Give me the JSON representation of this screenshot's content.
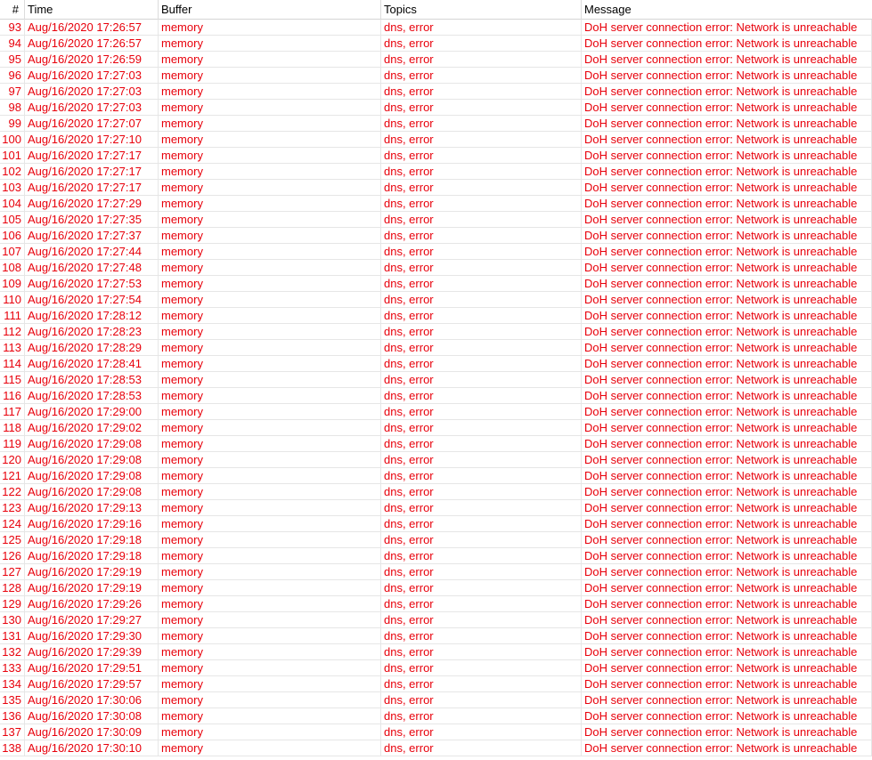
{
  "columns": {
    "num": "#",
    "time": "Time",
    "buffer": "Buffer",
    "topics": "Topics",
    "message": "Message"
  },
  "colors": {
    "error_text": "#e8000b",
    "header_text": "#000000",
    "grid_line": "#e6e6e6"
  },
  "rows": [
    {
      "num": "93",
      "time": "Aug/16/2020 17:26:57",
      "buffer": "memory",
      "topics": "dns, error",
      "message": "DoH server connection error: Network is unreachable"
    },
    {
      "num": "94",
      "time": "Aug/16/2020 17:26:57",
      "buffer": "memory",
      "topics": "dns, error",
      "message": "DoH server connection error: Network is unreachable"
    },
    {
      "num": "95",
      "time": "Aug/16/2020 17:26:59",
      "buffer": "memory",
      "topics": "dns, error",
      "message": "DoH server connection error: Network is unreachable"
    },
    {
      "num": "96",
      "time": "Aug/16/2020 17:27:03",
      "buffer": "memory",
      "topics": "dns, error",
      "message": "DoH server connection error: Network is unreachable"
    },
    {
      "num": "97",
      "time": "Aug/16/2020 17:27:03",
      "buffer": "memory",
      "topics": "dns, error",
      "message": "DoH server connection error: Network is unreachable"
    },
    {
      "num": "98",
      "time": "Aug/16/2020 17:27:03",
      "buffer": "memory",
      "topics": "dns, error",
      "message": "DoH server connection error: Network is unreachable"
    },
    {
      "num": "99",
      "time": "Aug/16/2020 17:27:07",
      "buffer": "memory",
      "topics": "dns, error",
      "message": "DoH server connection error: Network is unreachable"
    },
    {
      "num": "100",
      "time": "Aug/16/2020 17:27:10",
      "buffer": "memory",
      "topics": "dns, error",
      "message": "DoH server connection error: Network is unreachable"
    },
    {
      "num": "101",
      "time": "Aug/16/2020 17:27:17",
      "buffer": "memory",
      "topics": "dns, error",
      "message": "DoH server connection error: Network is unreachable"
    },
    {
      "num": "102",
      "time": "Aug/16/2020 17:27:17",
      "buffer": "memory",
      "topics": "dns, error",
      "message": "DoH server connection error: Network is unreachable"
    },
    {
      "num": "103",
      "time": "Aug/16/2020 17:27:17",
      "buffer": "memory",
      "topics": "dns, error",
      "message": "DoH server connection error: Network is unreachable"
    },
    {
      "num": "104",
      "time": "Aug/16/2020 17:27:29",
      "buffer": "memory",
      "topics": "dns, error",
      "message": "DoH server connection error: Network is unreachable"
    },
    {
      "num": "105",
      "time": "Aug/16/2020 17:27:35",
      "buffer": "memory",
      "topics": "dns, error",
      "message": "DoH server connection error: Network is unreachable"
    },
    {
      "num": "106",
      "time": "Aug/16/2020 17:27:37",
      "buffer": "memory",
      "topics": "dns, error",
      "message": "DoH server connection error: Network is unreachable"
    },
    {
      "num": "107",
      "time": "Aug/16/2020 17:27:44",
      "buffer": "memory",
      "topics": "dns, error",
      "message": "DoH server connection error: Network is unreachable"
    },
    {
      "num": "108",
      "time": "Aug/16/2020 17:27:48",
      "buffer": "memory",
      "topics": "dns, error",
      "message": "DoH server connection error: Network is unreachable"
    },
    {
      "num": "109",
      "time": "Aug/16/2020 17:27:53",
      "buffer": "memory",
      "topics": "dns, error",
      "message": "DoH server connection error: Network is unreachable"
    },
    {
      "num": "110",
      "time": "Aug/16/2020 17:27:54",
      "buffer": "memory",
      "topics": "dns, error",
      "message": "DoH server connection error: Network is unreachable"
    },
    {
      "num": "111",
      "time": "Aug/16/2020 17:28:12",
      "buffer": "memory",
      "topics": "dns, error",
      "message": "DoH server connection error: Network is unreachable"
    },
    {
      "num": "112",
      "time": "Aug/16/2020 17:28:23",
      "buffer": "memory",
      "topics": "dns, error",
      "message": "DoH server connection error: Network is unreachable"
    },
    {
      "num": "113",
      "time": "Aug/16/2020 17:28:29",
      "buffer": "memory",
      "topics": "dns, error",
      "message": "DoH server connection error: Network is unreachable"
    },
    {
      "num": "114",
      "time": "Aug/16/2020 17:28:41",
      "buffer": "memory",
      "topics": "dns, error",
      "message": "DoH server connection error: Network is unreachable"
    },
    {
      "num": "115",
      "time": "Aug/16/2020 17:28:53",
      "buffer": "memory",
      "topics": "dns, error",
      "message": "DoH server connection error: Network is unreachable"
    },
    {
      "num": "116",
      "time": "Aug/16/2020 17:28:53",
      "buffer": "memory",
      "topics": "dns, error",
      "message": "DoH server connection error: Network is unreachable"
    },
    {
      "num": "117",
      "time": "Aug/16/2020 17:29:00",
      "buffer": "memory",
      "topics": "dns, error",
      "message": "DoH server connection error: Network is unreachable"
    },
    {
      "num": "118",
      "time": "Aug/16/2020 17:29:02",
      "buffer": "memory",
      "topics": "dns, error",
      "message": "DoH server connection error: Network is unreachable"
    },
    {
      "num": "119",
      "time": "Aug/16/2020 17:29:08",
      "buffer": "memory",
      "topics": "dns, error",
      "message": "DoH server connection error: Network is unreachable"
    },
    {
      "num": "120",
      "time": "Aug/16/2020 17:29:08",
      "buffer": "memory",
      "topics": "dns, error",
      "message": "DoH server connection error: Network is unreachable"
    },
    {
      "num": "121",
      "time": "Aug/16/2020 17:29:08",
      "buffer": "memory",
      "topics": "dns, error",
      "message": "DoH server connection error: Network is unreachable"
    },
    {
      "num": "122",
      "time": "Aug/16/2020 17:29:08",
      "buffer": "memory",
      "topics": "dns, error",
      "message": "DoH server connection error: Network is unreachable"
    },
    {
      "num": "123",
      "time": "Aug/16/2020 17:29:13",
      "buffer": "memory",
      "topics": "dns, error",
      "message": "DoH server connection error: Network is unreachable"
    },
    {
      "num": "124",
      "time": "Aug/16/2020 17:29:16",
      "buffer": "memory",
      "topics": "dns, error",
      "message": "DoH server connection error: Network is unreachable"
    },
    {
      "num": "125",
      "time": "Aug/16/2020 17:29:18",
      "buffer": "memory",
      "topics": "dns, error",
      "message": "DoH server connection error: Network is unreachable"
    },
    {
      "num": "126",
      "time": "Aug/16/2020 17:29:18",
      "buffer": "memory",
      "topics": "dns, error",
      "message": "DoH server connection error: Network is unreachable"
    },
    {
      "num": "127",
      "time": "Aug/16/2020 17:29:19",
      "buffer": "memory",
      "topics": "dns, error",
      "message": "DoH server connection error: Network is unreachable"
    },
    {
      "num": "128",
      "time": "Aug/16/2020 17:29:19",
      "buffer": "memory",
      "topics": "dns, error",
      "message": "DoH server connection error: Network is unreachable"
    },
    {
      "num": "129",
      "time": "Aug/16/2020 17:29:26",
      "buffer": "memory",
      "topics": "dns, error",
      "message": "DoH server connection error: Network is unreachable"
    },
    {
      "num": "130",
      "time": "Aug/16/2020 17:29:27",
      "buffer": "memory",
      "topics": "dns, error",
      "message": "DoH server connection error: Network is unreachable"
    },
    {
      "num": "131",
      "time": "Aug/16/2020 17:29:30",
      "buffer": "memory",
      "topics": "dns, error",
      "message": "DoH server connection error: Network is unreachable"
    },
    {
      "num": "132",
      "time": "Aug/16/2020 17:29:39",
      "buffer": "memory",
      "topics": "dns, error",
      "message": "DoH server connection error: Network is unreachable"
    },
    {
      "num": "133",
      "time": "Aug/16/2020 17:29:51",
      "buffer": "memory",
      "topics": "dns, error",
      "message": "DoH server connection error: Network is unreachable"
    },
    {
      "num": "134",
      "time": "Aug/16/2020 17:29:57",
      "buffer": "memory",
      "topics": "dns, error",
      "message": "DoH server connection error: Network is unreachable"
    },
    {
      "num": "135",
      "time": "Aug/16/2020 17:30:06",
      "buffer": "memory",
      "topics": "dns, error",
      "message": "DoH server connection error: Network is unreachable"
    },
    {
      "num": "136",
      "time": "Aug/16/2020 17:30:08",
      "buffer": "memory",
      "topics": "dns, error",
      "message": "DoH server connection error: Network is unreachable"
    },
    {
      "num": "137",
      "time": "Aug/16/2020 17:30:09",
      "buffer": "memory",
      "topics": "dns, error",
      "message": "DoH server connection error: Network is unreachable"
    },
    {
      "num": "138",
      "time": "Aug/16/2020 17:30:10",
      "buffer": "memory",
      "topics": "dns, error",
      "message": "DoH server connection error: Network is unreachable"
    }
  ]
}
